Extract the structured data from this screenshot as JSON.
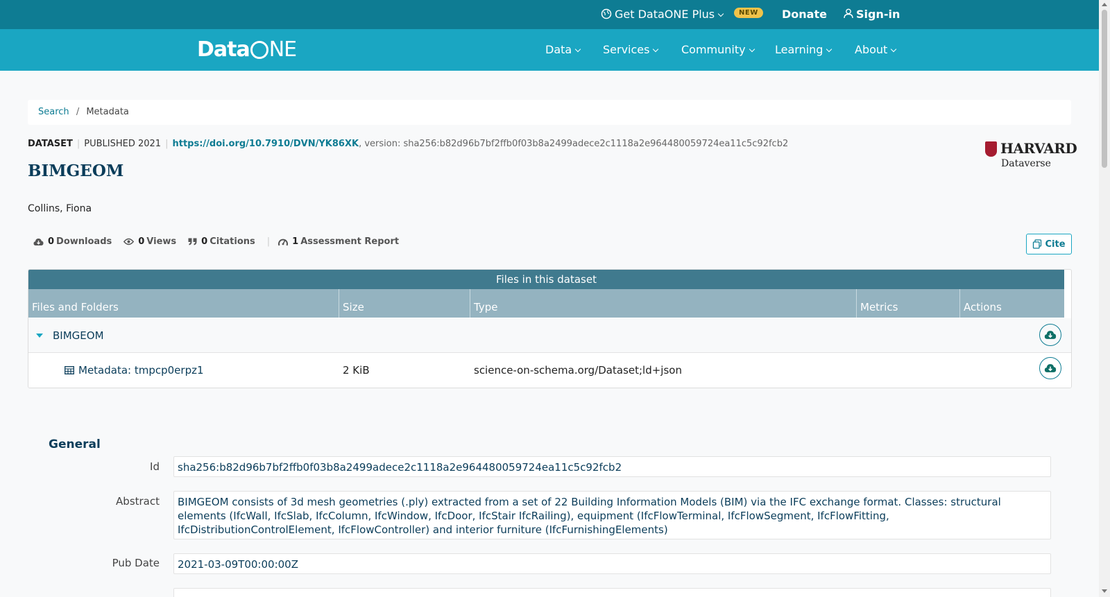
{
  "topbar": {
    "get_plus": "Get DataONE Plus",
    "new_badge": "NEW",
    "donate": "Donate",
    "signin": "Sign-in"
  },
  "nav": {
    "logo_data": "Data",
    "logo_ne": "NE",
    "items": [
      "Data",
      "Services",
      "Community",
      "Learning",
      "About"
    ]
  },
  "breadcrumb": {
    "search": "Search",
    "current": "Metadata"
  },
  "meta": {
    "type": "DATASET",
    "published": "PUBLISHED 2021",
    "doi": "https://doi.org/10.7910/DVN/YK86XK",
    "version": ", version: sha256:b82d96b7bf2ffb0f03b8a2499adece2c1118a2e964480059724ea11c5c92fcb2"
  },
  "title": "BIMGEOM",
  "repository": {
    "name": "HARVARD",
    "sub": "Dataverse"
  },
  "author": "Collins, Fiona",
  "stats": {
    "downloads_count": "0",
    "downloads_label": "Downloads",
    "views_count": "0",
    "views_label": "Views",
    "citations_count": "0",
    "citations_label": "Citations",
    "assessment_count": "1",
    "assessment_label": "Assessment Report"
  },
  "cite_label": "Cite",
  "files": {
    "heading": "Files in this dataset",
    "columns": [
      "Files and Folders",
      "Size",
      "Type",
      "Metrics",
      "Actions"
    ],
    "folder": "BIMGEOM",
    "file": {
      "name": "Metadata: tmpcp0erpz1",
      "size": "2 KiB",
      "type": "science-on-schema.org/Dataset;ld+json"
    }
  },
  "general": {
    "heading": "General",
    "id_label": "Id",
    "id_value": "sha256:b82d96b7bf2ffb0f03b8a2499adece2c1118a2e964480059724ea11c5c92fcb2",
    "abstract_label": "Abstract",
    "abstract_value": "BIMGEOM consists of 3d mesh geometries (.ply) extracted from a set of 22 Building Information Models (BIM) via the IFC exchange format. Classes: structural elements (IfcWall, IfcSlab, IfcColumn, IfcWindow, IfcDoor, IfcStair IfcRailing), equipment (IfcFlowTerminal, IfcFlowSegment, IfcFlowFitting, IfcDistributionControlElement, IfcFlowController) and interior furniture (IfcFurnishingElements)",
    "pubdate_label": "Pub Date",
    "pubdate_value": "2021-03-09T00:00:00Z"
  },
  "colors": {
    "topbar": "#0e7c93",
    "navbar": "#1aa6c2",
    "files_header": "#407a8e",
    "files_columns": "#94b3c0"
  },
  "icons": [
    "globe-icon",
    "user-icon",
    "cloud-download-icon",
    "eye-icon",
    "quote-icon",
    "gauge-icon",
    "copy-icon",
    "table-icon",
    "caret-down-icon"
  ]
}
